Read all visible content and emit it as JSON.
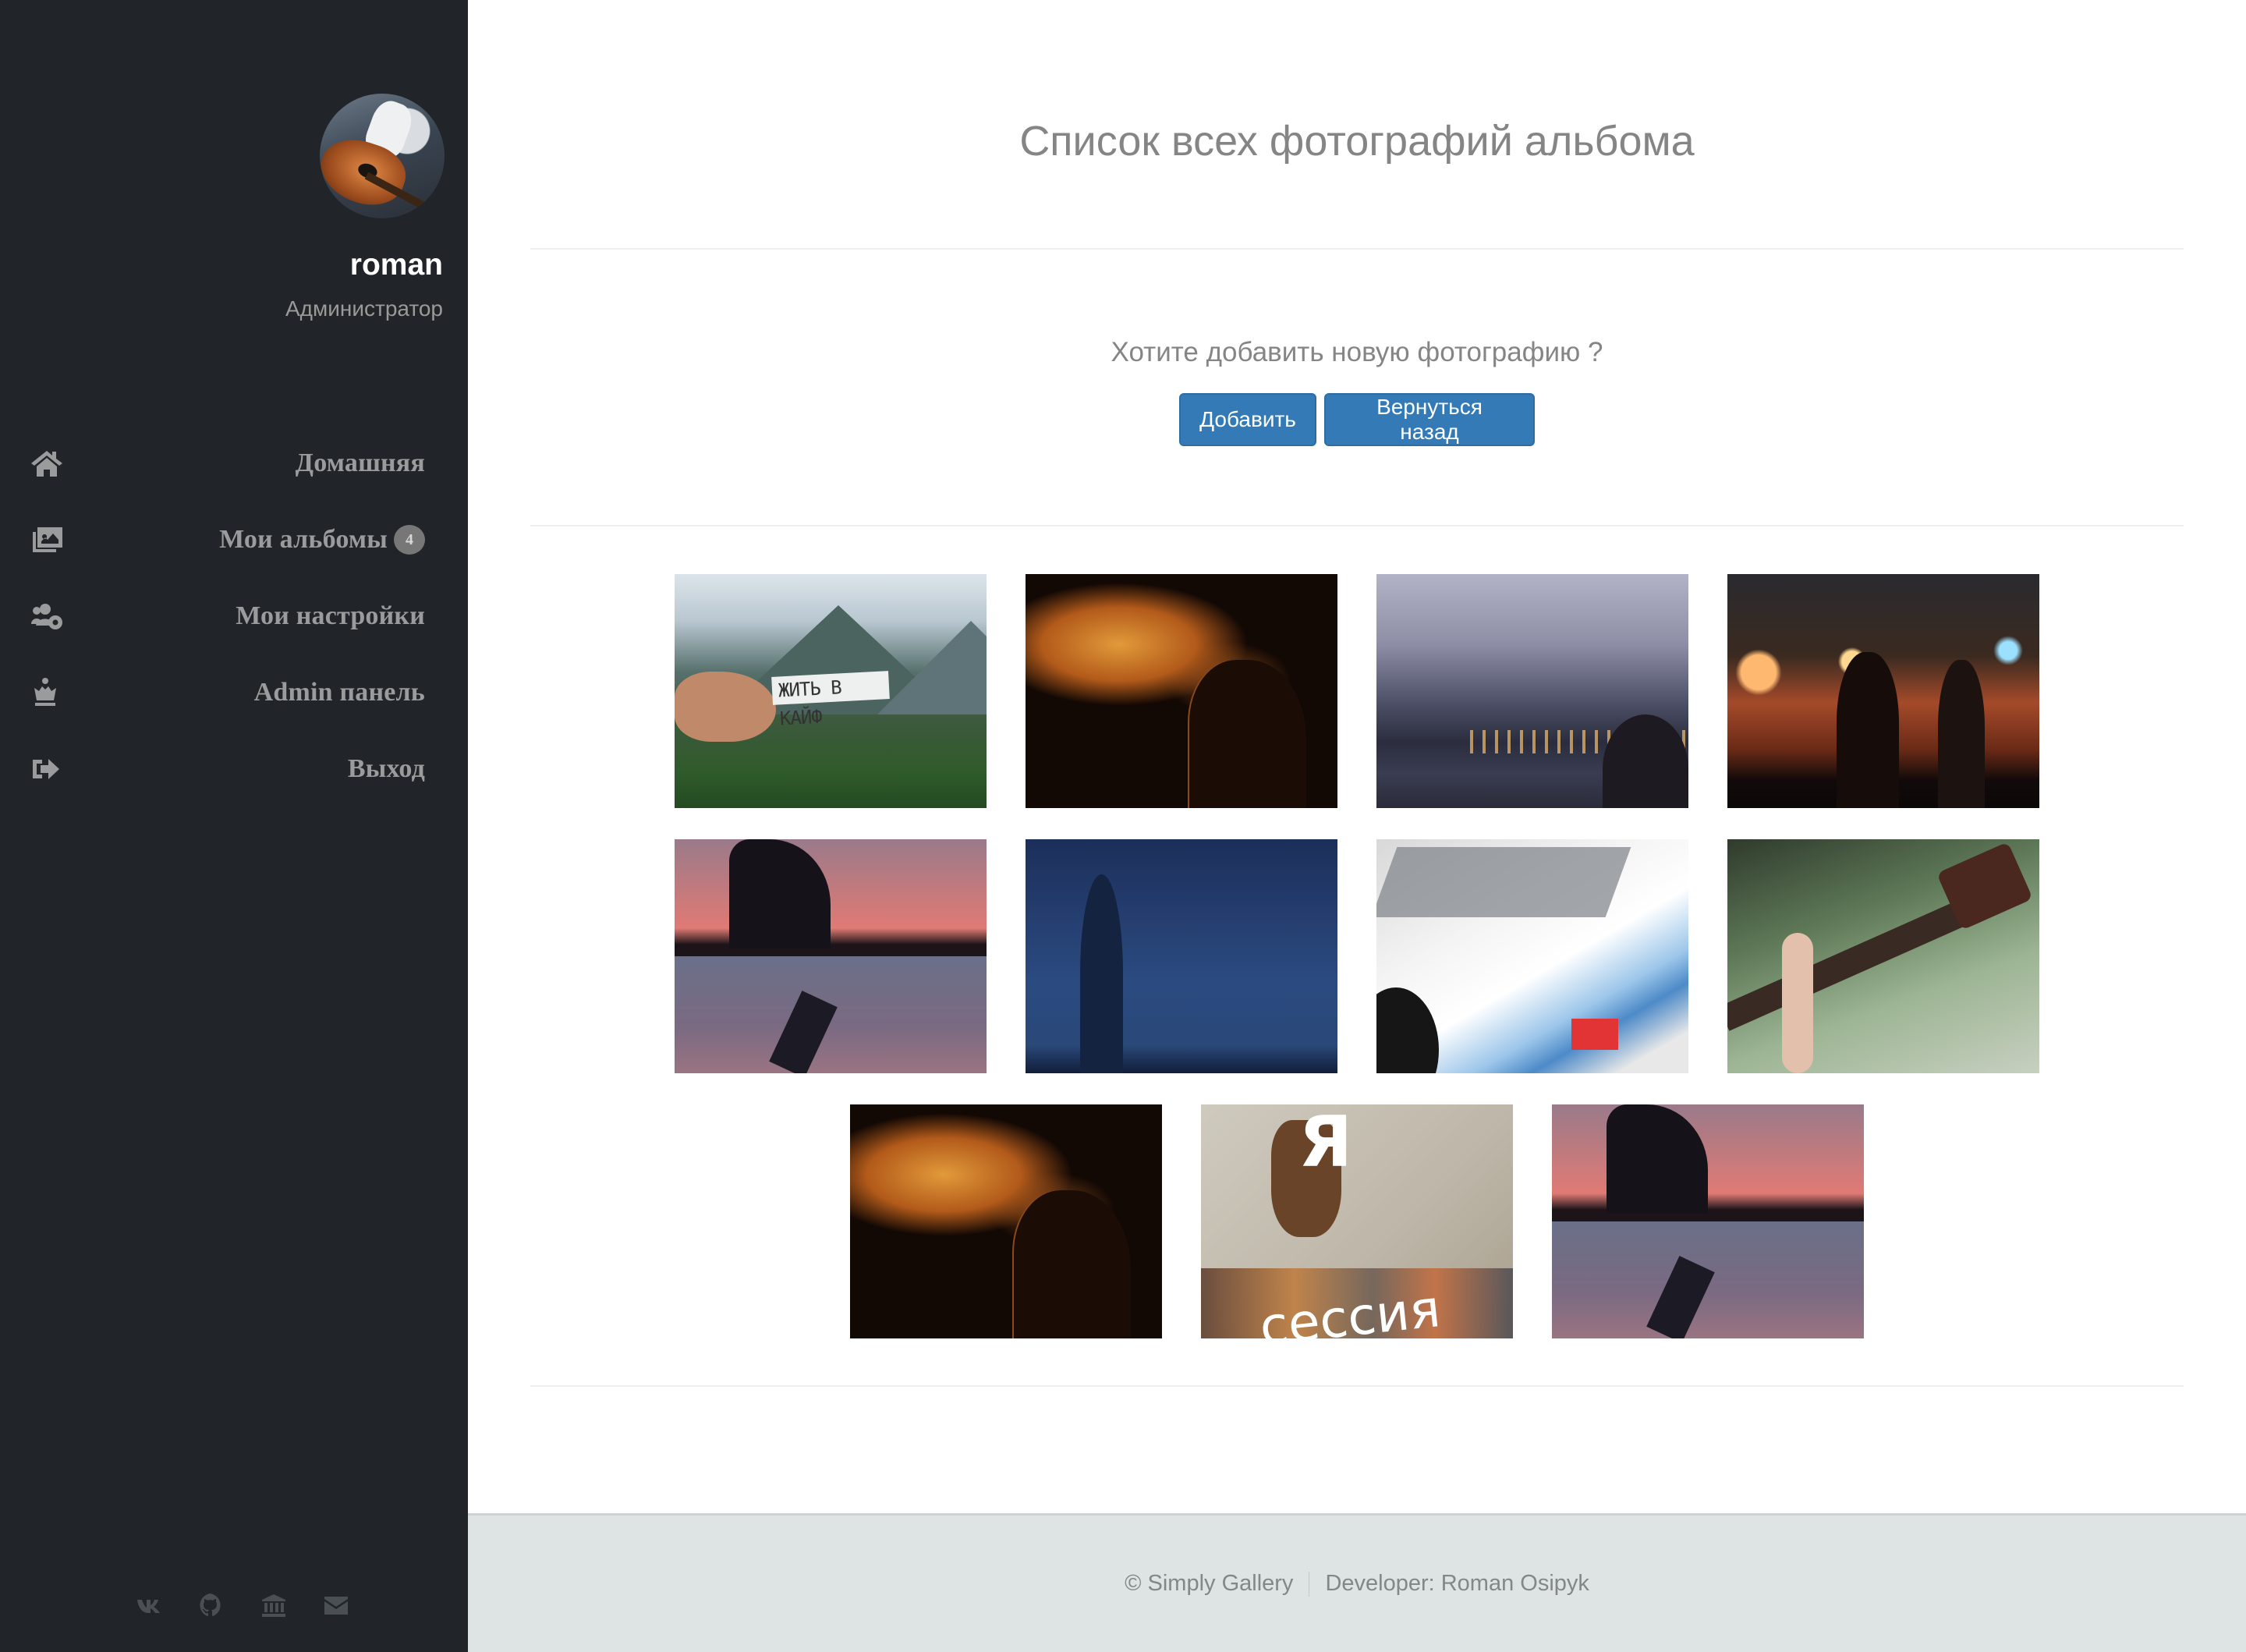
{
  "sidebar": {
    "avatar_alt": "user-avatar-guitar",
    "user_name": "roman",
    "user_role": "Администратор",
    "nav": [
      {
        "label": "Домашняя",
        "icon": "home-icon"
      },
      {
        "label": "Мои альбомы",
        "icon": "images-icon",
        "badge": "4"
      },
      {
        "label": "Мои настройки",
        "icon": "users-cog-icon"
      },
      {
        "label": "Admin панель",
        "icon": "chess-queen-icon"
      },
      {
        "label": "Выход",
        "icon": "sign-out-icon"
      }
    ],
    "social": [
      {
        "name": "vk-icon"
      },
      {
        "name": "github-icon"
      },
      {
        "name": "university-icon"
      },
      {
        "name": "envelope-icon"
      }
    ]
  },
  "main": {
    "title": "Список всех фотографий альбома",
    "prompt": "Хотите добавить новую фотографию ?",
    "add_button": "Добавить",
    "back_button": "Вернуться назад",
    "photos": [
      {
        "subject": "hand holding sign in front of mountains",
        "sign_text": "ЖИТЬ В КАЙФ"
      },
      {
        "subject": "person exhaling orange smoke at night"
      },
      {
        "subject": "hooded person facing city skyline over water at dusk"
      },
      {
        "subject": "couple sitting on rooftop over night city lights"
      },
      {
        "subject": "silhouette dancing at pink sunset collage"
      },
      {
        "subject": "woman in coat against deep blue sky"
      },
      {
        "subject": "white race car with blue stripes"
      },
      {
        "subject": "hand playing acoustic guitar"
      },
      {
        "subject": "person exhaling orange smoke at night"
      },
      {
        "subject": "meme: person cornered by toy dinosaurs",
        "caption_top": "Я",
        "caption_bottom": "сессия"
      },
      {
        "subject": "silhouette dancing at pink sunset collage"
      }
    ]
  },
  "footer": {
    "copyright": "© Simply Gallery",
    "developer": "Developer: Roman Osipyk"
  },
  "colors": {
    "sidebar_bg": "#212428",
    "button_primary": "#337ab7",
    "footer_bg": "#dee3e3",
    "muted_text": "#858585"
  }
}
